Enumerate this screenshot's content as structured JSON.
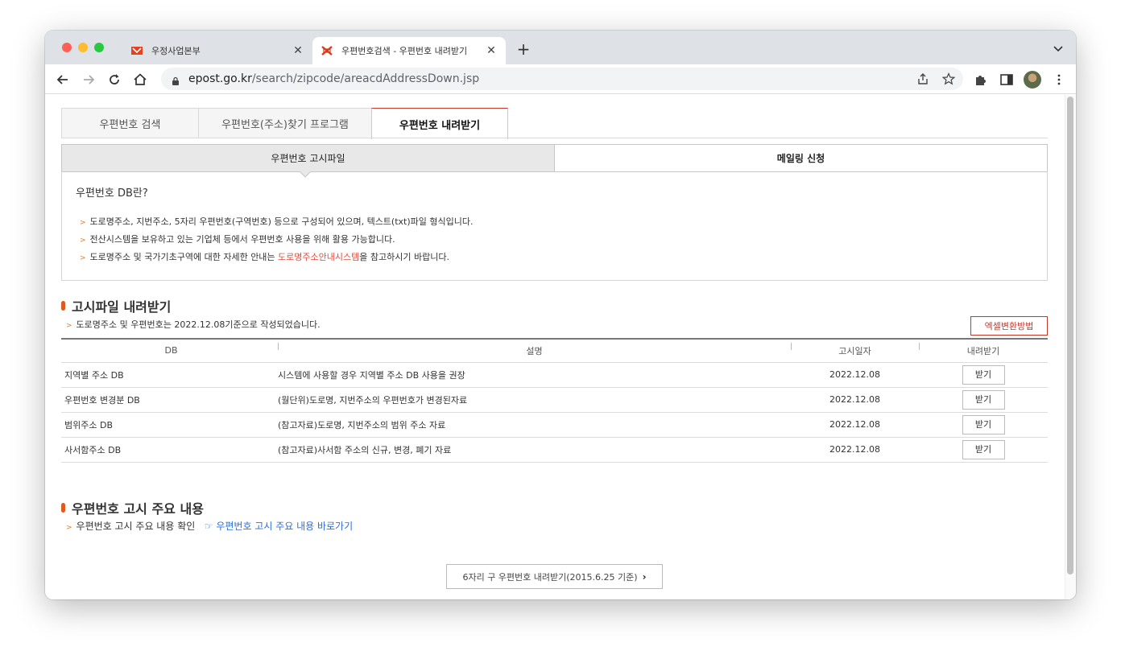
{
  "browser": {
    "tabs": [
      {
        "title": "우정사업본부",
        "active": false
      },
      {
        "title": "우편번호검색 - 우편번호 내려받기",
        "active": true
      }
    ],
    "url_domain": "epost.go.kr",
    "url_path": "/search/zipcode/areacdAddressDown.jsp"
  },
  "page_tabs": [
    "우편번호 검색",
    "우편번호(주소)찾기 프로그램",
    "우편번호 내려받기"
  ],
  "sub_tabs": [
    "우편번호 고시파일",
    "메일링 신청"
  ],
  "info": {
    "title": "우편번호 DB란?",
    "items": [
      "도로명주소, 지번주소, 5자리 우편번호(구역번호) 등으로 구성되어 있으며, 텍스트(txt)파일 형식입니다.",
      "전산시스템을 보유하고 있는 기업체 등에서 우편번호 사용을 위해 활용 가능합니다."
    ],
    "item3_before": "도로명주소 및 국가기초구역에 대한 자세한 안내는 ",
    "item3_link": "도로명주소안내시스템",
    "item3_after": "을 참고하시기 바랍니다."
  },
  "download_section": {
    "title": "고시파일 내려받기",
    "note": "도로명주소 및 우편번호는 2022.12.08기준으로 작성되었습니다.",
    "excel_button": "엑셀변환방법",
    "columns": [
      "DB",
      "설명",
      "고시일자",
      "내려받기"
    ],
    "rows": [
      {
        "db": "지역별 주소 DB",
        "desc": "시스템에 사용할 경우 지역별 주소 DB 사용을 권장",
        "date": "2022.12.08",
        "btn": "받기"
      },
      {
        "db": "우편번호 변경분 DB",
        "desc": "(월단위)도로명, 지번주소의 우편번호가 변경된자료",
        "date": "2022.12.08",
        "btn": "받기"
      },
      {
        "db": "범위주소 DB",
        "desc": "(참고자료)도로명, 지번주소의 범위 주소 자료",
        "date": "2022.12.08",
        "btn": "받기"
      },
      {
        "db": "사서함주소 DB",
        "desc": "(참고자료)사서함 주소의 신규, 변경, 폐기 자료",
        "date": "2022.12.08",
        "btn": "받기"
      }
    ]
  },
  "notice_section": {
    "title": "우편번호 고시 주요 내용",
    "note": "우편번호 고시 주요 내용 확인",
    "link": "☞ 우편번호 고시 주요 내용 바로가기"
  },
  "old_download_button": "6자리 구 우편번호 내려받기(2015.6.25 기준)",
  "colors": {
    "accent_red": "#c0392b",
    "bullet_orange": "#e67e22",
    "link_blue": "#2e6fd6"
  }
}
